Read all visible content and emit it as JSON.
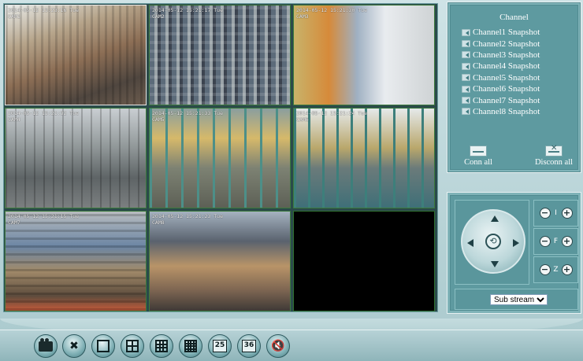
{
  "cameras": [
    {
      "osd_line1": "2014-05-12 15:23:16 Tue",
      "osd_line2": "CAM1",
      "active": true
    },
    {
      "osd_line1": "2014-05-12 15:21:17 Tue",
      "osd_line2": "CAM2",
      "active": false
    },
    {
      "osd_line1": "2014-05-12 15:21:30 Tue",
      "osd_line2": "CAM3",
      "active": false
    },
    {
      "osd_line1": "2014-05-12 15:21:32 Tue",
      "osd_line2": "CAM4",
      "active": false
    },
    {
      "osd_line1": "2014-05-12 15:21:33 Tue",
      "osd_line2": "CAM5",
      "active": false
    },
    {
      "osd_line1": "2014-05-12 15:21:24 Tue",
      "osd_line2": "CAM6",
      "active": false
    },
    {
      "osd_line1": "2014-05-12 15:21:15 Tue",
      "osd_line2": "CAM7",
      "active": false
    },
    {
      "osd_line1": "2014-05-12 15:21:23 Tue",
      "osd_line2": "CAM8",
      "active": false
    }
  ],
  "channel_panel": {
    "title": "Channel",
    "items": [
      "Channel1 Snapshot",
      "Channel2 Snapshot",
      "Channel3 Snapshot",
      "Channel4 Snapshot",
      "Channel5 Snapshot",
      "Channel6 Snapshot",
      "Channel7 Snapshot",
      "Channel8 Snapshot"
    ],
    "conn_all": "Conn all",
    "disconn_all": "Disconn all"
  },
  "ptz": {
    "iris_label": "I",
    "focus_label": "F",
    "zoom_label": "Z",
    "minus": "−",
    "plus": "+",
    "center_glyph": "⟲",
    "stream_selected": "Sub stream"
  },
  "toolbar": {
    "split_25": "25",
    "split_36": "36"
  },
  "colors": {
    "panel_bg": "#5e9aa0",
    "panel_border": "#e6f0f1",
    "active_border": "#e8e8e8",
    "grid_border": "#3c7a3c"
  }
}
